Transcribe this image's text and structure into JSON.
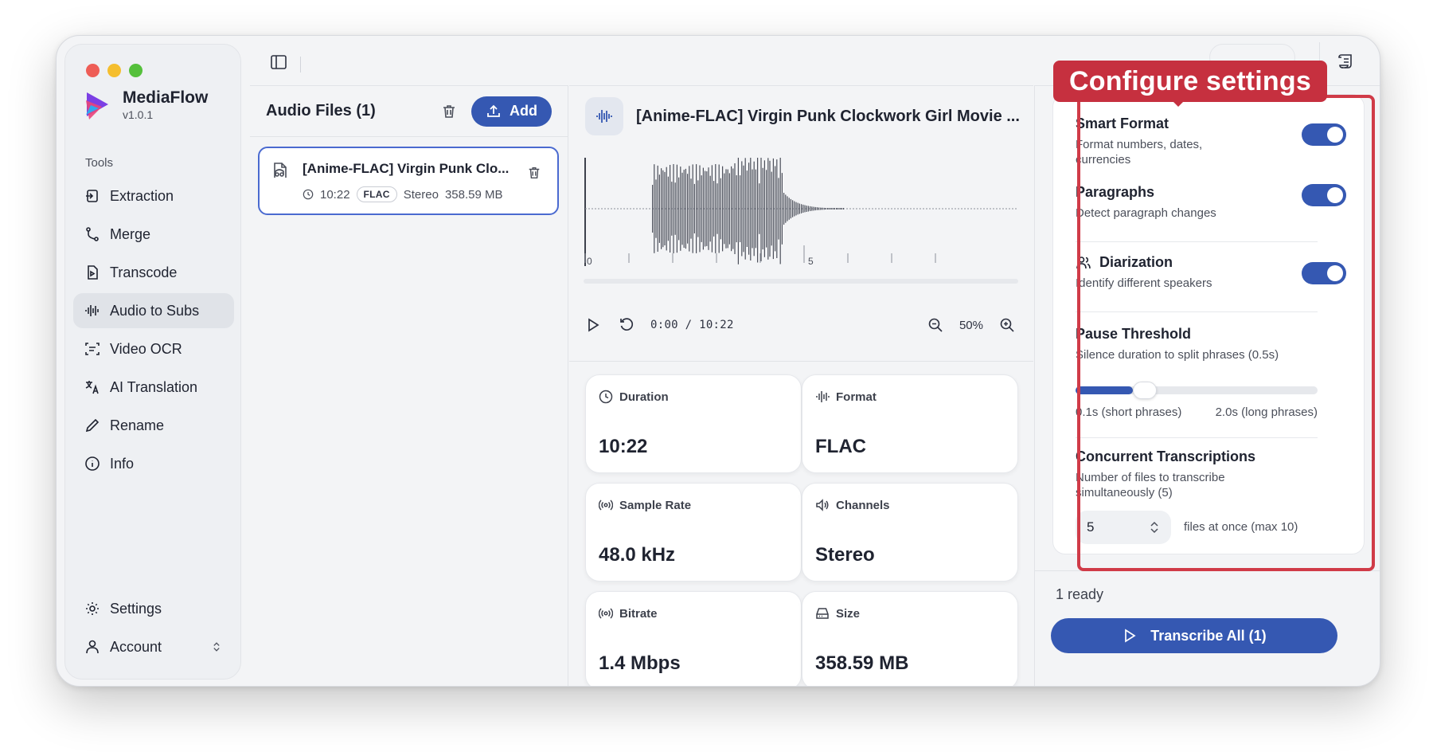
{
  "app": {
    "name": "MediaFlow",
    "version": "v1.0.1"
  },
  "sidebar": {
    "section_label": "Tools",
    "items": [
      {
        "label": "Extraction",
        "icon": "extraction-icon"
      },
      {
        "label": "Merge",
        "icon": "merge-icon"
      },
      {
        "label": "Transcode",
        "icon": "transcode-icon"
      },
      {
        "label": "Audio to Subs",
        "icon": "audio-waveform-icon",
        "active": true
      },
      {
        "label": "Video OCR",
        "icon": "scan-text-icon"
      },
      {
        "label": "AI Translation",
        "icon": "translate-icon"
      },
      {
        "label": "Rename",
        "icon": "pen-icon"
      },
      {
        "label": "Info",
        "icon": "info-icon"
      }
    ],
    "bottom": [
      {
        "label": "Settings",
        "icon": "gear-icon"
      },
      {
        "label": "Account",
        "icon": "user-icon"
      }
    ]
  },
  "files": {
    "title": "Audio Files (1)",
    "add_label": "Add",
    "items": [
      {
        "name": "[Anime-FLAC] Virgin Punk Clo...",
        "duration": "10:22",
        "format": "FLAC",
        "channels": "Stereo",
        "size": "358.59 MB"
      }
    ]
  },
  "detail": {
    "title": "[Anime-FLAC] Virgin Punk Clockwork Girl Movie ...",
    "waveform_ticks": [
      "0",
      "5"
    ],
    "time": "0:00 / 10:22",
    "zoom": "50%",
    "cards": [
      {
        "label": "Duration",
        "value": "10:22",
        "icon": "clock-icon"
      },
      {
        "label": "Format",
        "value": "FLAC",
        "icon": "audio-waveform-icon"
      },
      {
        "label": "Sample Rate",
        "value": "48.0 kHz",
        "icon": "radio-icon"
      },
      {
        "label": "Channels",
        "value": "Stereo",
        "icon": "speaker-icon"
      },
      {
        "label": "Bitrate",
        "value": "1.4 Mbps",
        "icon": "broadcast-icon"
      },
      {
        "label": "Size",
        "value": "358.59 MB",
        "icon": "hard-drive-icon"
      }
    ]
  },
  "settings": {
    "smart_format": {
      "title": "Smart Format",
      "desc": "Format numbers, dates, currencies",
      "on": true
    },
    "paragraphs": {
      "title": "Paragraphs",
      "desc": "Detect paragraph changes",
      "on": true
    },
    "diarization": {
      "title": "Diarization",
      "desc": "Identify different speakers",
      "on": true
    },
    "pause_threshold": {
      "title": "Pause Threshold",
      "desc": "Silence duration to split phrases (0.5s)",
      "min_label": "0.1s (short phrases)",
      "max_label": "2.0s (long phrases)",
      "value": 0.5,
      "min": 0.1,
      "max": 2.0
    },
    "concurrent": {
      "title": "Concurrent Transcriptions",
      "desc": "Number of files to transcribe simultaneously (5)",
      "value": "5",
      "suffix": "files at once (max 10)"
    }
  },
  "footer": {
    "status": "1 ready",
    "transcribe_label": "Transcribe All (1)"
  },
  "annotation": {
    "callout": "Configure settings",
    "color": "#c6303f"
  },
  "colors": {
    "accent": "#3558b2"
  }
}
